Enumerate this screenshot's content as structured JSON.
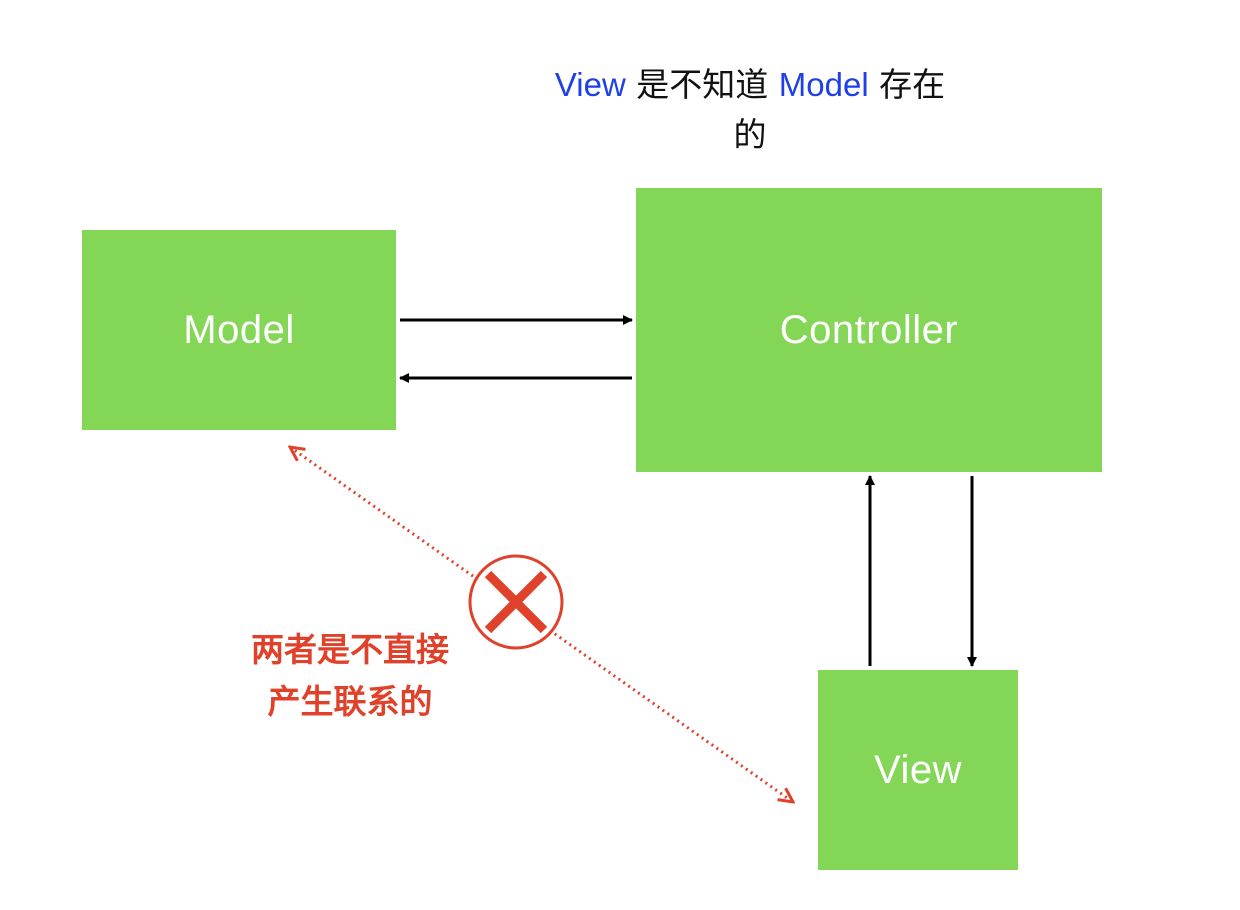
{
  "boxes": {
    "model": "Model",
    "controller": "Controller",
    "view": "View"
  },
  "top_note": {
    "view_word": "View",
    "middle_text": " 是不知道 ",
    "model_word": "Model",
    "tail_line1": " 存在",
    "tail_line2": "的"
  },
  "red_note": {
    "line1": "两者是不直接",
    "line2": "产生联系的"
  },
  "colors": {
    "box_fill": "#84d657",
    "box_text": "#ffffff",
    "arrow": "#000000",
    "highlight_blue": "#1f40e6",
    "forbidden_red": "#e0412a"
  },
  "icons": [
    "cross-circle-icon"
  ]
}
